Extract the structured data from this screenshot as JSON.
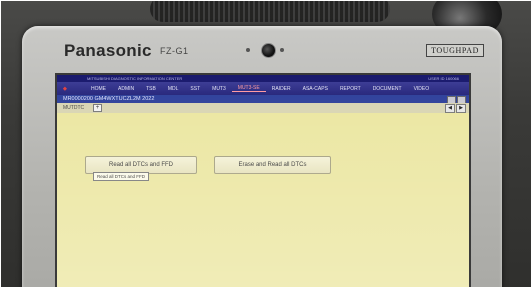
{
  "device": {
    "brand": "Panasonic",
    "model": "FZ-G1",
    "badge": "TOUGHPAD"
  },
  "app": {
    "header_title": "MITSUBISHI DIAGNOSTIC INFORMATION CENTER",
    "user_label": "USER ID",
    "user_id": "160066",
    "menu": [
      {
        "label": "HOME",
        "active": false
      },
      {
        "label": "ADMIN",
        "active": false
      },
      {
        "label": "TSB",
        "active": false
      },
      {
        "label": "MDL",
        "active": false
      },
      {
        "label": "SST",
        "active": false
      },
      {
        "label": "MUT3",
        "active": false
      },
      {
        "label": "MUT3-SE",
        "active": true
      },
      {
        "label": "RAIDER",
        "active": false
      },
      {
        "label": "ASA-CAPS",
        "active": false
      },
      {
        "label": "REPORT",
        "active": false
      },
      {
        "label": "DOCUMENT",
        "active": false
      },
      {
        "label": "VIDEO",
        "active": false
      }
    ],
    "vehicle_info": "MR0000200  GM4WXTUCZL2M 2022",
    "tabs_label": "MUTDTC",
    "tab_add": "+",
    "nav_prev": "◀",
    "nav_next": "▶",
    "read_button": "Read all DTCs and FFD",
    "erase_button": "Erase and Read all DTCs",
    "tooltip": "Read all DTCs and FFD"
  },
  "colors": {
    "screen_bg": "#ebe6a0",
    "menubar": "#24247a",
    "active_menu": "#ff9aa0"
  }
}
